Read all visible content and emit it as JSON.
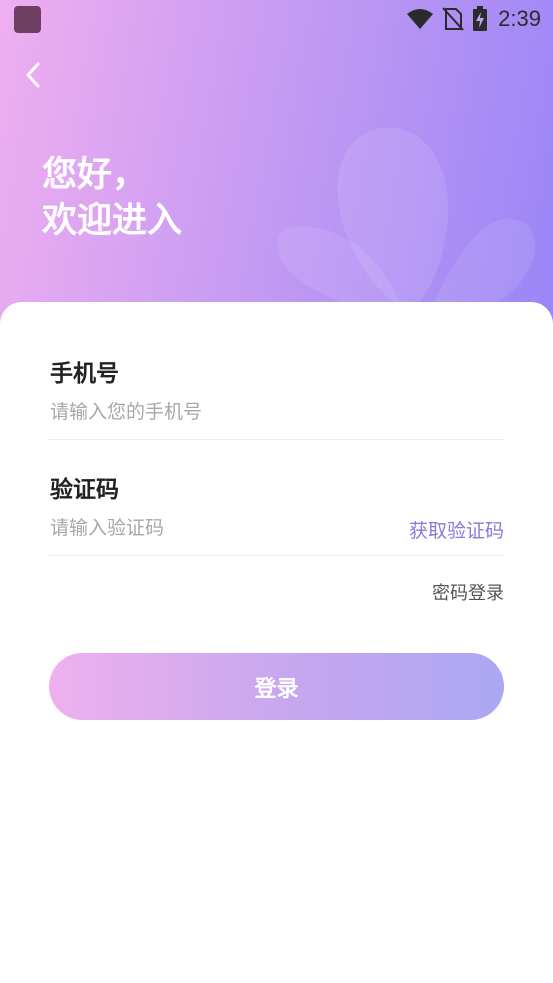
{
  "status_bar": {
    "time": "2:39",
    "icons": [
      "app-icon",
      "wifi-icon",
      "no-sim-icon",
      "battery-charging-icon"
    ]
  },
  "header": {
    "back_icon": "chevron-left-icon",
    "greeting_line1": "您好，",
    "greeting_line2": "欢迎进入"
  },
  "form": {
    "phone": {
      "label": "手机号",
      "placeholder": "请输入您的手机号",
      "value": ""
    },
    "code": {
      "label": "验证码",
      "placeholder": "请输入验证码",
      "value": "",
      "get_code_label": "获取验证码"
    },
    "password_login_label": "密码登录",
    "login_button_label": "登录"
  },
  "colors": {
    "gradient_start": "#efaef0",
    "gradient_end": "#9a86f7",
    "accent": "#8b78d6"
  }
}
